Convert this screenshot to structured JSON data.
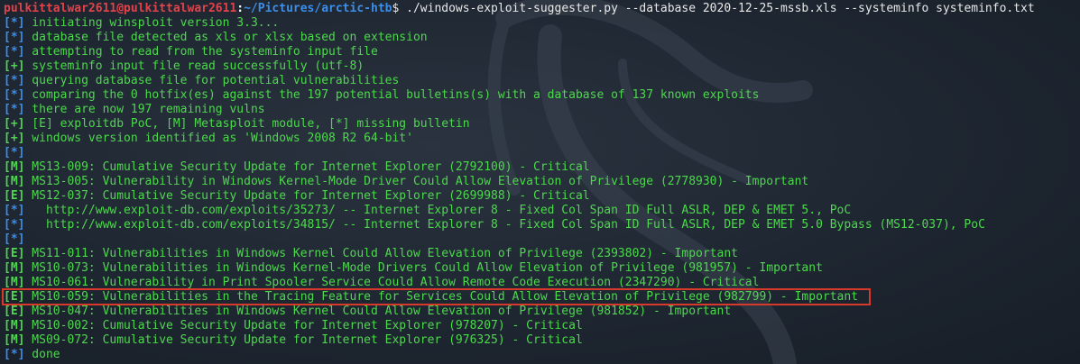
{
  "prompt": {
    "user_host": "pulkittalwar2611@pulkittalwar2611",
    "separator": ":",
    "path": "~/Pictures/arctic-htb",
    "symbol": "$",
    "command": " ./windows-exploit-suggester.py --database 2020-12-25-mssb.xls --systeminfo systeminfo.txt"
  },
  "lines": [
    {
      "tag": "[*]",
      "kind": "b",
      "text": " initiating winsploit version 3.3..."
    },
    {
      "tag": "[*]",
      "kind": "b",
      "text": " database file detected as xls or xlsx based on extension"
    },
    {
      "tag": "[*]",
      "kind": "b",
      "text": " attempting to read from the systeminfo input file"
    },
    {
      "tag": "[+]",
      "kind": "g",
      "text": " systeminfo input file read successfully (utf-8)"
    },
    {
      "tag": "[*]",
      "kind": "b",
      "text": " querying database file for potential vulnerabilities"
    },
    {
      "tag": "[*]",
      "kind": "b",
      "text": " comparing the 0 hotfix(es) against the 197 potential bulletins(s) with a database of 137 known exploits"
    },
    {
      "tag": "[*]",
      "kind": "b",
      "text": " there are now 197 remaining vulns"
    },
    {
      "tag": "[+]",
      "kind": "g",
      "text": " [E] exploitdb PoC, [M] Metasploit module, [*] missing bulletin"
    },
    {
      "tag": "[+]",
      "kind": "g",
      "text": " windows version identified as 'Windows 2008 R2 64-bit'"
    },
    {
      "tag": "[*]",
      "kind": "b",
      "text": ""
    },
    {
      "tag": "[M]",
      "kind": "g",
      "text": " MS13-009: Cumulative Security Update for Internet Explorer (2792100) - Critical"
    },
    {
      "tag": "[M]",
      "kind": "g",
      "text": " MS13-005: Vulnerability in Windows Kernel-Mode Driver Could Allow Elevation of Privilege (2778930) - Important"
    },
    {
      "tag": "[E]",
      "kind": "g",
      "text": " MS12-037: Cumulative Security Update for Internet Explorer (2699988) - Critical"
    },
    {
      "tag": "[*]",
      "kind": "b",
      "text": "   http://www.exploit-db.com/exploits/35273/ -- Internet Explorer 8 - Fixed Col Span ID Full ASLR, DEP & EMET 5., PoC"
    },
    {
      "tag": "[*]",
      "kind": "b",
      "text": "   http://www.exploit-db.com/exploits/34815/ -- Internet Explorer 8 - Fixed Col Span ID Full ASLR, DEP & EMET 5.0 Bypass (MS12-037), PoC"
    },
    {
      "tag": "[*]",
      "kind": "b",
      "text": ""
    },
    {
      "tag": "[E]",
      "kind": "g",
      "text": " MS11-011: Vulnerabilities in Windows Kernel Could Allow Elevation of Privilege (2393802) - Important"
    },
    {
      "tag": "[M]",
      "kind": "g",
      "text": " MS10-073: Vulnerabilities in Windows Kernel-Mode Drivers Could Allow Elevation of Privilege (981957) - Important"
    },
    {
      "tag": "[M]",
      "kind": "g",
      "text": " MS10-061: Vulnerability in Print Spooler Service Could Allow Remote Code Execution (2347290) - Critical"
    },
    {
      "tag": "[E]",
      "kind": "g",
      "text": " MS10-059: Vulnerabilities in the Tracing Feature for Services Could Allow Elevation of Privilege (982799) - Important",
      "highlight": true
    },
    {
      "tag": "[E]",
      "kind": "g",
      "text": " MS10-047: Vulnerabilities in Windows Kernel Could Allow Elevation of Privilege (981852) - Important"
    },
    {
      "tag": "[M]",
      "kind": "g",
      "text": " MS10-002: Cumulative Security Update for Internet Explorer (978207) - Critical"
    },
    {
      "tag": "[M]",
      "kind": "g",
      "text": " MS09-072: Cumulative Security Update for Internet Explorer (976325) - Critical"
    },
    {
      "tag": "[*]",
      "kind": "b",
      "text": " done"
    }
  ],
  "colors": {
    "background": "#1d2530",
    "green": "#4dd84d",
    "blue": "#3b8eea",
    "prompt_user": "#e0434b",
    "highlight_border": "#d73a2a"
  },
  "icons": {
    "background_logo": "kali-dragon-icon"
  }
}
